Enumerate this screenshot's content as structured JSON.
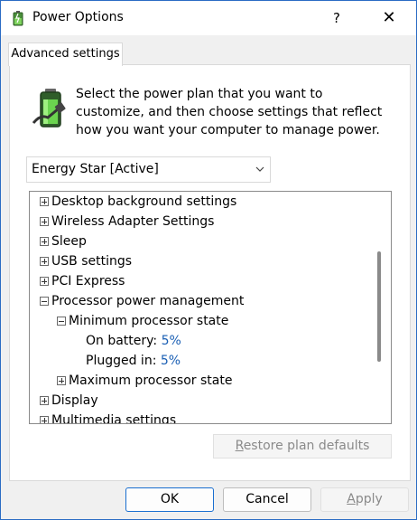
{
  "window": {
    "title": "Power Options",
    "help_glyph": "?",
    "close_glyph": "✕",
    "icon": "power-options-icon"
  },
  "tab": {
    "label": "Advanced settings"
  },
  "intro": {
    "text": "Select the power plan that you want to customize, and then choose settings that reflect how you want your computer to manage power.",
    "icon": "battery-plug-icon"
  },
  "plan_select": {
    "value": "Energy Star [Active]"
  },
  "tree": {
    "items": [
      {
        "label": "Desktop background settings",
        "level": 0,
        "expander": "+",
        "value": ""
      },
      {
        "label": "Wireless Adapter Settings",
        "level": 0,
        "expander": "+",
        "value": ""
      },
      {
        "label": "Sleep",
        "level": 0,
        "expander": "+",
        "value": ""
      },
      {
        "label": "USB settings",
        "level": 0,
        "expander": "+",
        "value": ""
      },
      {
        "label": "PCI Express",
        "level": 0,
        "expander": "+",
        "value": ""
      },
      {
        "label": "Processor power management",
        "level": 0,
        "expander": "-",
        "value": ""
      },
      {
        "label": "Minimum processor state",
        "level": 1,
        "expander": "-",
        "value": ""
      },
      {
        "label": "On battery:",
        "level": 2,
        "expander": "",
        "value": "5%"
      },
      {
        "label": "Plugged in:",
        "level": 2,
        "expander": "",
        "value": "5%"
      },
      {
        "label": "Maximum processor state",
        "level": 1,
        "expander": "+",
        "value": ""
      },
      {
        "label": "Display",
        "level": 0,
        "expander": "+",
        "value": ""
      },
      {
        "label": "Multimedia settings",
        "level": 0,
        "expander": "+",
        "value": ""
      }
    ]
  },
  "buttons": {
    "restore_prefix": "",
    "restore_underlined": "R",
    "restore_rest": "estore plan defaults",
    "ok": "OK",
    "cancel": "Cancel",
    "apply_underlined": "A",
    "apply_rest": "pply"
  },
  "colors": {
    "accent": "#1a6fd0",
    "value_link": "#1a5fb4",
    "window_border": "#2b6cc4"
  }
}
